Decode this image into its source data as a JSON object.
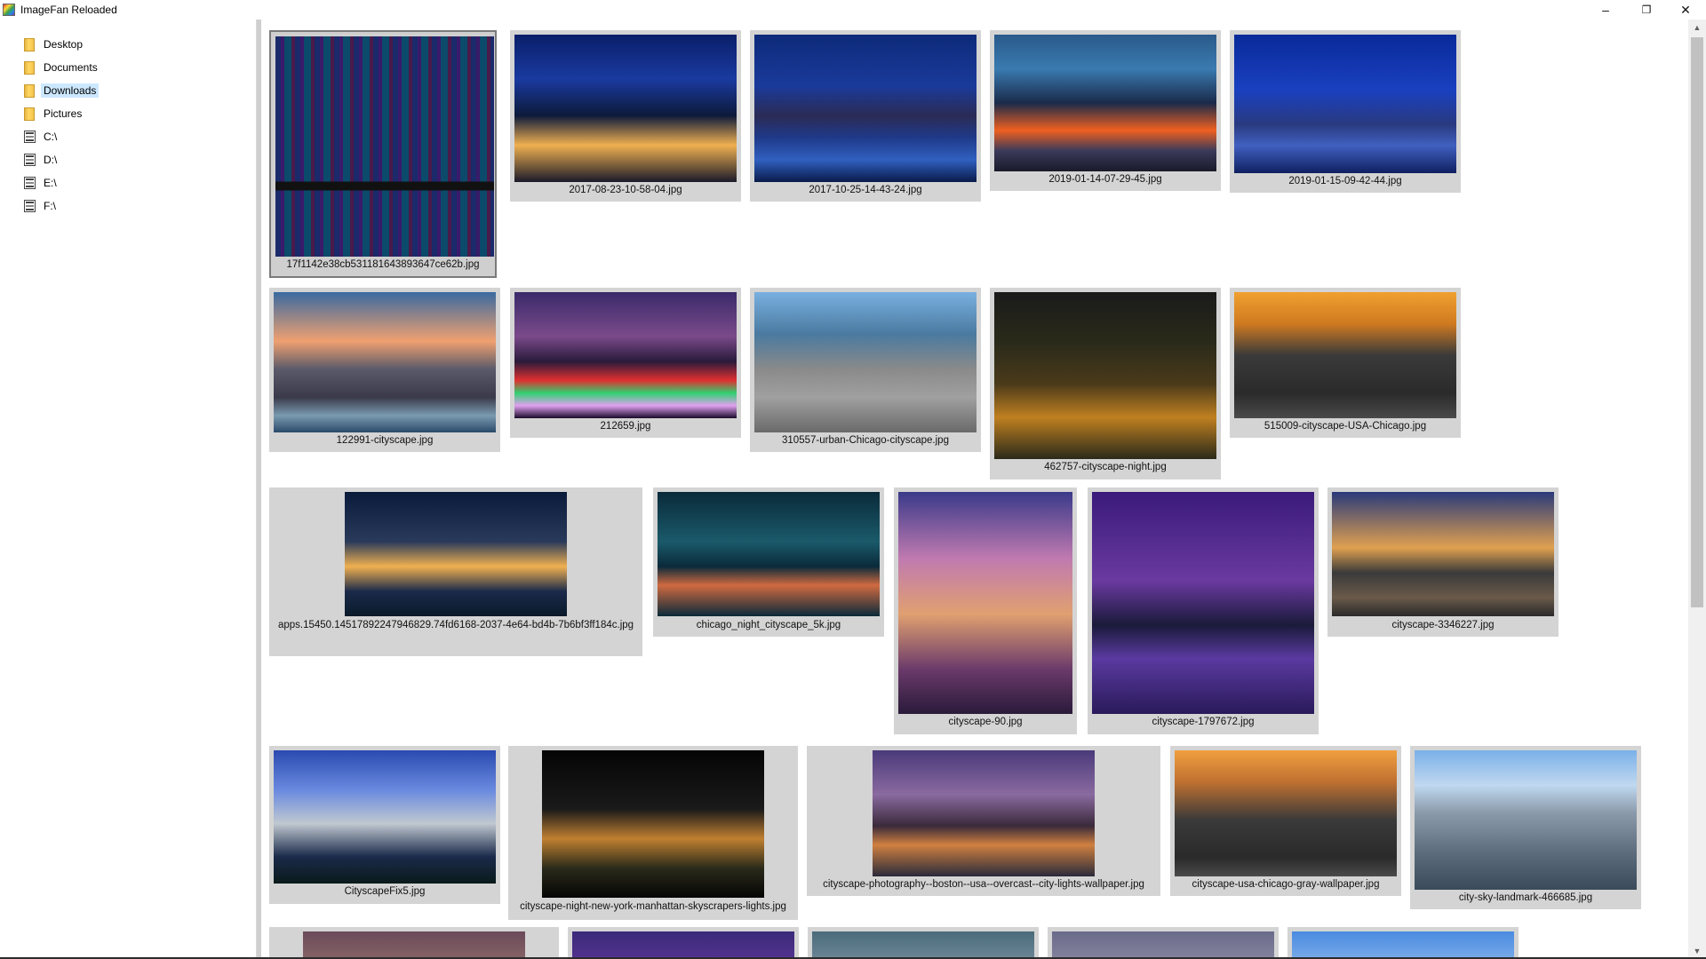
{
  "window": {
    "title": "ImageFan Reloaded",
    "minimize_glyph": "–",
    "maximize_glyph": "❐",
    "close_glyph": "✕"
  },
  "sidebar": {
    "items": [
      {
        "label": "Desktop",
        "icon": "folder-icon",
        "selected": false
      },
      {
        "label": "Documents",
        "icon": "folder-icon",
        "selected": false
      },
      {
        "label": "Downloads",
        "icon": "folder-icon",
        "selected": true
      },
      {
        "label": "Pictures",
        "icon": "folder-icon",
        "selected": false
      },
      {
        "label": "C:\\",
        "icon": "drive-icon",
        "selected": false
      },
      {
        "label": "D:\\",
        "icon": "drive-icon",
        "selected": false
      },
      {
        "label": "E:\\",
        "icon": "drive-icon",
        "selected": false
      },
      {
        "label": "F:\\",
        "icon": "drive-icon",
        "selected": false
      }
    ]
  },
  "thumbnails": [
    {
      "caption": "17f1142e38cb531181643893647ce62b.jpg",
      "selected": true
    },
    {
      "caption": "2017-08-23-10-58-04.jpg"
    },
    {
      "caption": "2017-10-25-14-43-24.jpg"
    },
    {
      "caption": "2019-01-14-07-29-45.jpg"
    },
    {
      "caption": "2019-01-15-09-42-44.jpg"
    },
    {
      "caption": "122991-cityscape.jpg"
    },
    {
      "caption": "212659.jpg"
    },
    {
      "caption": "310557-urban-Chicago-cityscape.jpg"
    },
    {
      "caption": "462757-cityscape-night.jpg"
    },
    {
      "caption": "515009-cityscape-USA-Chicago.jpg"
    },
    {
      "caption": "apps.15450.14517892247946829.74fd6168-2037-4e64-bd4b-7b6bf3ff184c.jpg"
    },
    {
      "caption": "chicago_night_cityscape_5k.jpg"
    },
    {
      "caption": "cityscape-90.jpg"
    },
    {
      "caption": "cityscape-1797672.jpg"
    },
    {
      "caption": "cityscape-3346227.jpg"
    },
    {
      "caption": "CityscapeFix5.jpg"
    },
    {
      "caption": "cityscape-night-new-york-manhattan-skyscrapers-lights.jpg"
    },
    {
      "caption": "cityscape-photography--boston--usa--overcast--city-lights-wallpaper.jpg"
    },
    {
      "caption": "cityscape-usa-chicago-gray-wallpaper.jpg"
    },
    {
      "caption": "city-sky-landmark-466685.jpg"
    }
  ],
  "scrollbar": {
    "up_glyph": "▲",
    "down_glyph": "▼"
  }
}
